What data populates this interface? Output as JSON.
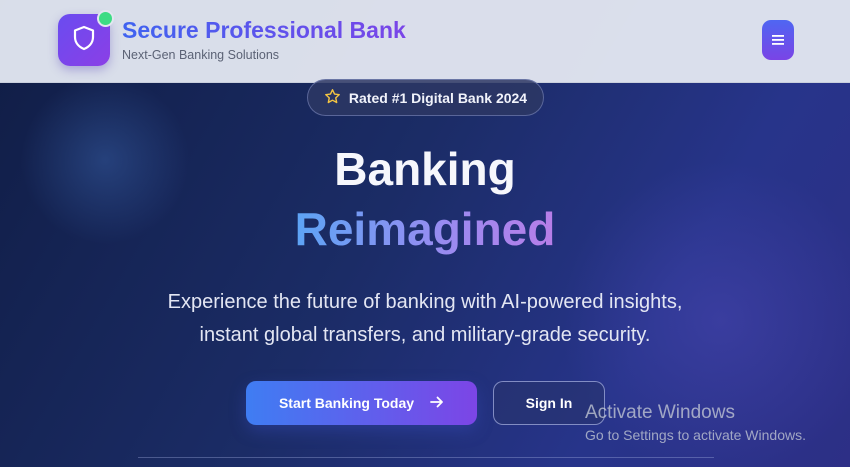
{
  "header": {
    "brand_title": "Secure Professional Bank",
    "brand_subtitle": "Next-Gen Banking Solutions",
    "logo_icon": "shield-icon",
    "menu_icon": "menu-icon"
  },
  "hero": {
    "badge_text": "Rated #1 Digital Bank 2024",
    "badge_icon": "star-icon",
    "title_line1": "Banking",
    "title_line2": "Reimagined",
    "subtitle_line1": "Experience the future of banking with AI-powered insights,",
    "subtitle_line2": "instant global transfers, and military-grade security.",
    "primary_button": "Start Banking Today",
    "secondary_button": "Sign In"
  },
  "watermark": {
    "title": "Activate Windows",
    "subtitle": "Go to Settings to activate Windows."
  },
  "colors": {
    "accent_blue": "#3f63f0",
    "accent_purple": "#7a45e8",
    "status_green": "#3ddc84",
    "star_yellow": "#f4c542"
  }
}
